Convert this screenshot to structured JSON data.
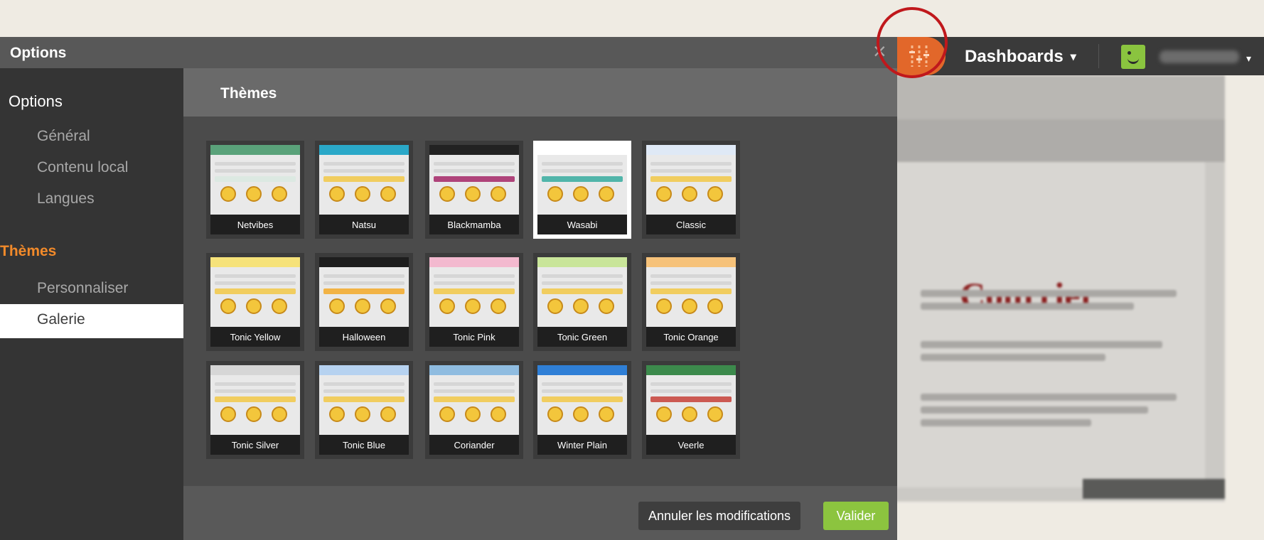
{
  "topbar": {
    "dashboards_label": "Dashboards",
    "dashboards_caret": "▾",
    "user_caret": "▾"
  },
  "background": {
    "logo_text": "Courrier"
  },
  "options": {
    "header_title": "Options",
    "close_glyph": "×",
    "sidebar": {
      "heading": "Options",
      "items": [
        "Général",
        "Contenu local",
        "Langues"
      ],
      "category": "Thèmes",
      "sub_items": [
        "Personnaliser",
        "Galerie"
      ],
      "active_item": "Galerie"
    },
    "content_title": "Thèmes",
    "themes": [
      {
        "name": "Netvibes",
        "header": "#5aa27a",
        "accent": "#d8e8e0",
        "selected": false
      },
      {
        "name": "Natsu",
        "header": "#2aa8c8",
        "accent": "#f3c63c",
        "selected": false
      },
      {
        "name": "Blackmamba",
        "header": "#222222",
        "accent": "#a0195e",
        "selected": false
      },
      {
        "name": "Wasabi",
        "header": "#ffffff",
        "accent": "#2aa89a",
        "selected": true
      },
      {
        "name": "Classic",
        "header": "#dfe9f6",
        "accent": "#f3c63c",
        "selected": false
      },
      {
        "name": "Tonic Yellow",
        "header": "#f6e27a",
        "accent": "#f3c63c",
        "selected": false
      },
      {
        "name": "Halloween",
        "header": "#1e1e1e",
        "accent": "#f4a51c",
        "selected": false
      },
      {
        "name": "Tonic Pink",
        "header": "#f3b9cf",
        "accent": "#f3c63c",
        "selected": false
      },
      {
        "name": "Tonic Green",
        "header": "#c9e59a",
        "accent": "#f3c63c",
        "selected": false
      },
      {
        "name": "Tonic Orange",
        "header": "#f6c27a",
        "accent": "#f3c63c",
        "selected": false
      },
      {
        "name": "Tonic Silver",
        "header": "#d6d6d6",
        "accent": "#f3c63c",
        "selected": false
      },
      {
        "name": "Tonic Blue",
        "header": "#b6d2f0",
        "accent": "#f3c63c",
        "selected": false
      },
      {
        "name": "Coriander",
        "header": "#8fbce0",
        "accent": "#f3c63c",
        "selected": false
      },
      {
        "name": "Winter Plain",
        "header": "#2f7fd6",
        "accent": "#f3c63c",
        "selected": false
      },
      {
        "name": "Veerle",
        "header": "#3c8a4c",
        "accent": "#c4342c",
        "selected": false
      }
    ],
    "buttons": {
      "cancel": "Annuler les modifications",
      "validate": "Valider"
    }
  },
  "colors": {
    "brand_orange": "#e2672a",
    "accent_green": "#8cc43f",
    "category_orange": "#f28a2a",
    "annotation_red": "#c0181c"
  }
}
